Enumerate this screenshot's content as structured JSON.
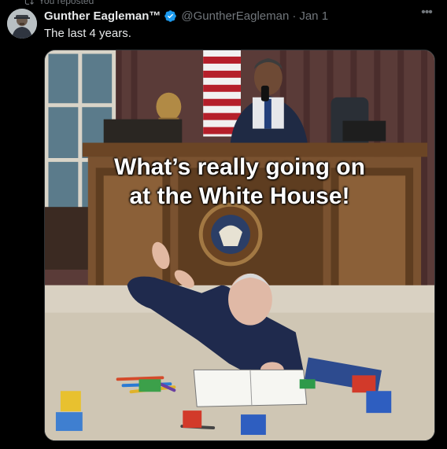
{
  "repost": {
    "label": "You reposted"
  },
  "author": {
    "name": "Gunther Eagleman™",
    "handle": "@GuntherEagleman",
    "separator": "·",
    "date": "Jan 1"
  },
  "tweet": {
    "text": "The last 4 years."
  },
  "more_icon": "more-horizontal-icon",
  "verified_color": "#1d9bf0",
  "media": {
    "caption_line1": "What’s really going on",
    "caption_line2": "at the White House!"
  }
}
